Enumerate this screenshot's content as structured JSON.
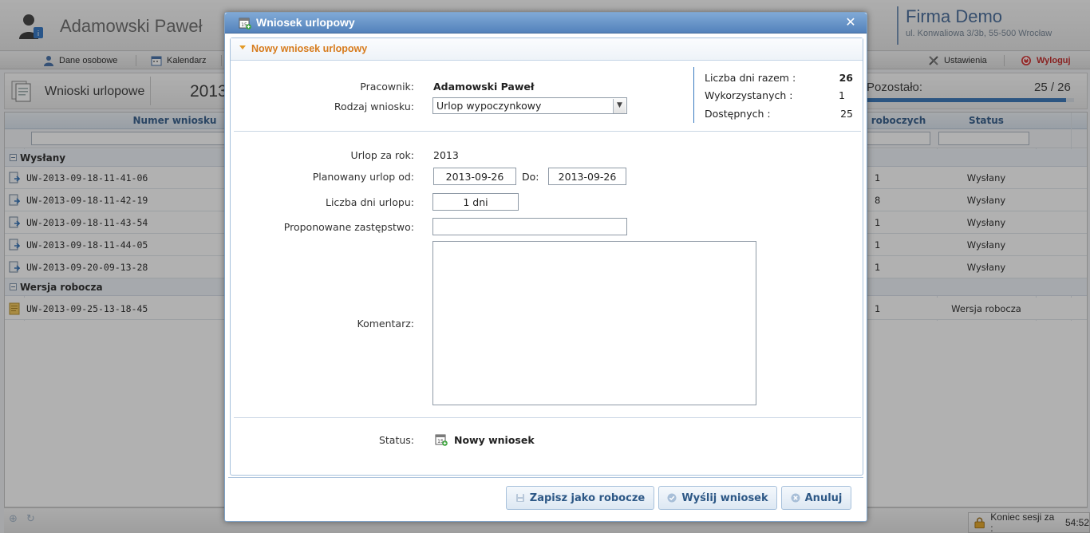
{
  "app": {
    "user_name": "Adamowski Paweł",
    "company_name": "Firma Demo",
    "company_address": "ul. Konwaliowa 3/3b, 55-500 Wrocław",
    "menu": {
      "personal": "Dane osobowe",
      "calendar": "Kalendarz",
      "settings": "Ustawienia",
      "logout": "Wyloguj"
    },
    "section_title": "Wnioski urlopowe",
    "year": "2013",
    "remaining_label": "Pozostało:",
    "remaining_value": "25 / 26",
    "remaining_fraction": 0.96,
    "grid": {
      "col_number": "Numer wniosku",
      "col_days": "roboczych",
      "col_status": "Status",
      "groups": [
        {
          "name": "Wysłany",
          "rows": [
            {
              "number": "UW-2013-09-18-11-41-06",
              "days": "1",
              "status": "Wysłany"
            },
            {
              "number": "UW-2013-09-18-11-42-19",
              "days": "8",
              "status": "Wysłany"
            },
            {
              "number": "UW-2013-09-18-11-43-54",
              "days": "1",
              "status": "Wysłany"
            },
            {
              "number": "UW-2013-09-18-11-44-05",
              "days": "1",
              "status": "Wysłany"
            },
            {
              "number": "UW-2013-09-20-09-13-28",
              "days": "1",
              "status": "Wysłany"
            }
          ]
        },
        {
          "name": "Wersja robocza",
          "rows": [
            {
              "number": "UW-2013-09-25-13-18-45",
              "days": "1",
              "status": "Wersja robocza"
            }
          ]
        }
      ]
    },
    "session_label": "Koniec sesji za :",
    "session_time": "54:52"
  },
  "dialog": {
    "title": "Wniosek urlopowy",
    "panel_title": "Nowy wniosek urlopowy",
    "employee_label": "Pracownik:",
    "employee_value": "Adamowski Paweł",
    "type_label": "Rodzaj wniosku:",
    "type_value": "Urlop wypoczynkowy",
    "summary": {
      "total_label": "Liczba dni razem :",
      "total_value": "26",
      "used_label": "Wykorzystanych :",
      "used_value": "1",
      "available_label": "Dostępnych :",
      "available_value": "25"
    },
    "year_label": "Urlop za rok:",
    "year_value": "2013",
    "from_label": "Planowany urlop od:",
    "from_value": "2013-09-26",
    "to_label": "Do:",
    "to_value": "2013-09-26",
    "days_label": "Liczba dni urlopu:",
    "days_value": "1 dni",
    "substitute_label": "Proponowane zastępstwo:",
    "substitute_value": "",
    "comment_label": "Komentarz:",
    "comment_value": "",
    "status_label": "Status:",
    "status_value": "Nowy wniosek",
    "buttons": {
      "save_draft": "Zapisz jako robocze",
      "send": "Wyślij wniosek",
      "cancel": "Anuluj"
    }
  }
}
